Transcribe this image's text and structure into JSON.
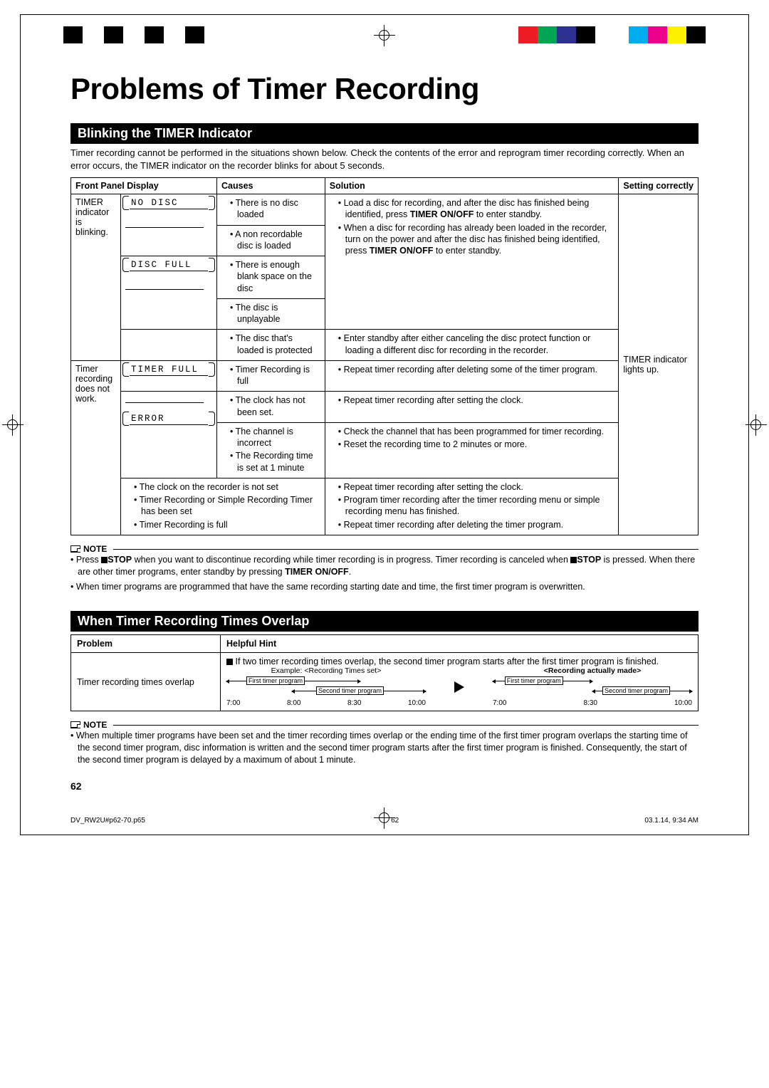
{
  "page": {
    "title": "Problems of Timer Recording",
    "page_number": "62"
  },
  "section1": {
    "heading": "Blinking the TIMER Indicator",
    "intro": "Timer recording cannot be performed in the situations shown below. Check the contents of the error and reprogram timer recording correctly. When an error occurs, the TIMER indicator on the recorder blinks for about 5 seconds.",
    "headers": {
      "col1": "Front Panel Display",
      "col2": "Causes",
      "col3": "Solution",
      "col4": "Setting correctly"
    },
    "state_label_1": "TIMER indicator is blinking.",
    "state_label_2": "Timer recording does not work.",
    "displays": {
      "no_disc": "NO  DISC",
      "disc_full": "DISC  FULL",
      "timer_full": "TIMER FULL",
      "error": "ERROR"
    },
    "causes": {
      "c1": "There is no disc loaded",
      "c2": "A non recordable disc is loaded",
      "c3": "There is enough blank space on the disc",
      "c4": "The disc is unplayable",
      "c5": "The disc that's loaded is protected",
      "c6": "Timer Recording is full",
      "c7": "The clock has not been set.",
      "c8": "The channel is incorrect",
      "c9": "The Recording time is set at 1 minute",
      "c10": "The clock on the recorder is not set",
      "c11": "Timer Recording or Simple Recording Timer has been set",
      "c12": "Timer Recording is full"
    },
    "solutions": {
      "s1a": "Load a disc for recording, and after the disc has finished being identified, press ",
      "s1b": "TIMER ON/OFF",
      "s1c": " to enter standby.",
      "s2a": "When a disc for recording has already been loaded in the recorder, turn on the power and after the disc has finished being identified, press ",
      "s2b": "TIMER ON/OFF",
      "s2c": " to enter standby.",
      "s3": "Enter standby after either canceling the disc protect function or loading a different disc for recording in the recorder.",
      "s4": "Repeat timer recording after deleting some of the timer program.",
      "s5": "Repeat timer recording after setting the clock.",
      "s6": "Check the channel that has been programmed for timer recording.",
      "s7": "Reset the recording time to 2 minutes or more.",
      "s8": "Repeat timer recording after setting the clock.",
      "s9": "Program timer recording after the timer recording menu or simple recording menu has finished.",
      "s10": "Repeat timer recording after deleting the timer program."
    },
    "setting_correctly": "TIMER indicator lights up."
  },
  "note1": {
    "label": "NOTE",
    "n1a": "Press ",
    "n1b": "STOP",
    "n1c": " when you want to discontinue recording while timer recording is in progress. Timer recording is canceled when ",
    "n1d": "STOP",
    "n1e": " is pressed. When there are other timer programs, enter standby by pressing ",
    "n1f": "TIMER ON/OFF",
    "n1g": ".",
    "n2": "When timer programs are programmed that have the same recording starting date and time, the first timer program is overwritten."
  },
  "section2": {
    "heading": "When Timer Recording Times Overlap",
    "headers": {
      "problem": "Problem",
      "hint": "Helpful Hint"
    },
    "problem_text": "Timer recording times overlap",
    "hint_intro": "If two timer recording times overlap, the second timer program starts after the first timer program is finished.",
    "example_left_title": "Example: <Recording Times set>",
    "example_right_title": "<Recording actually made>",
    "bar_first": "First timer program",
    "bar_second": "Second timer program",
    "ticks_left": [
      "7:00",
      "8:00",
      "8:30",
      "10:00"
    ],
    "ticks_right": [
      "7:00",
      "8:30",
      "10:00"
    ]
  },
  "note2": {
    "label": "NOTE",
    "text": "When multiple timer programs have been set and the timer recording times overlap or the ending time of the first timer program overlaps the starting time of the second timer program, disc information is written and the second timer program starts after the first timer program is finished. Consequently, the start of the second timer program is delayed by a maximum of about 1 minute."
  },
  "footer": {
    "file": "DV_RW2U#p62-70.p65",
    "pg": "62",
    "ts": "03.1.14, 9:34 AM"
  }
}
